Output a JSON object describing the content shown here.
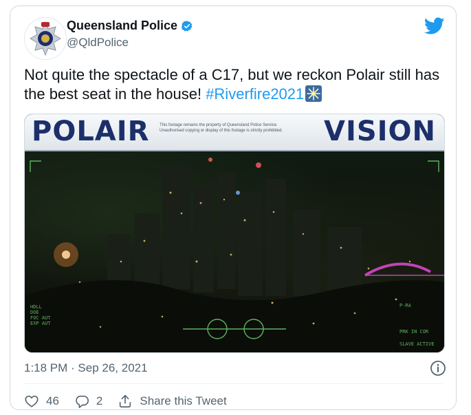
{
  "author": {
    "display_name": "Queensland Police",
    "handle": "@QldPolice",
    "verified": true,
    "avatar_icon": "police-badge-icon"
  },
  "tweet": {
    "text_before": "Not quite the spectacle of a C17, but we reckon Polair still has the best seat in the house! ",
    "hashtag": "#Riverfire2021",
    "emoji_icon": "sparkle-emoji-icon"
  },
  "media": {
    "banner_left": "POLAIR",
    "banner_right": "VISION",
    "disclaimer_line1": "This footage remains the property of Queensland Police Service.",
    "disclaimer_line2": "Unauthorised copying or display of this footage is strictly prohibited."
  },
  "meta": {
    "timestamp": "1:18 PM · Sep 26, 2021"
  },
  "actions": {
    "likes": "46",
    "replies": "2",
    "share_label": "Share this Tweet"
  },
  "colors": {
    "twitter_blue": "#1d9bf0",
    "text_primary": "#0f1419",
    "text_secondary": "#536471",
    "banner_navy": "#1c2f6b"
  }
}
